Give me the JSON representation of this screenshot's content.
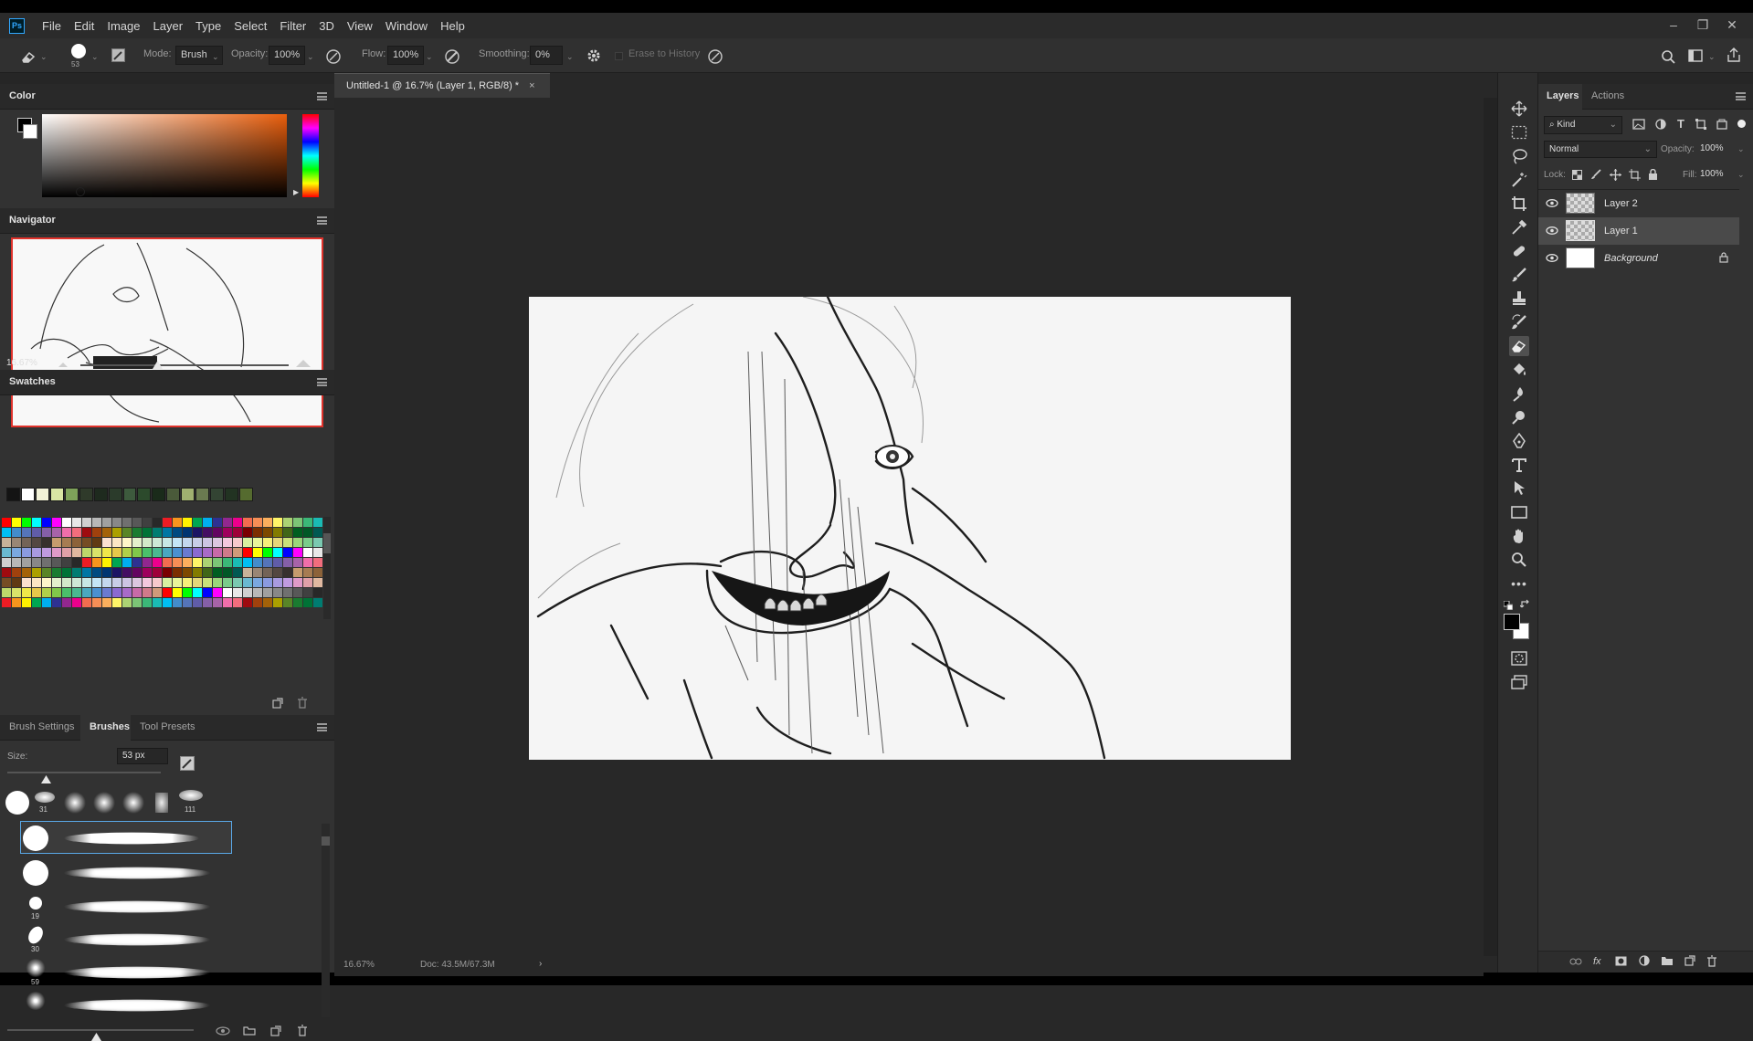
{
  "app": {
    "logo_text": "Ps"
  },
  "menu": [
    "File",
    "Edit",
    "Image",
    "Layer",
    "Type",
    "Select",
    "Filter",
    "3D",
    "View",
    "Window",
    "Help"
  ],
  "options_bar": {
    "brush_size": "53",
    "mode_label": "Mode:",
    "mode_value": "Brush",
    "opacity_label": "Opacity:",
    "opacity_value": "100%",
    "flow_label": "Flow:",
    "flow_value": "100%",
    "smoothing_label": "Smoothing:",
    "smoothing_value": "0%",
    "erase_history_label": "Erase to History"
  },
  "color_panel": {
    "title": "Color",
    "hue_color": "#e95e0c"
  },
  "navigator": {
    "title": "Navigator",
    "zoom": "16.67%"
  },
  "swatches": {
    "title": "Swatches",
    "recent": [
      "#141414",
      "#ffffff",
      "#f2f2d8",
      "#d9e6a4",
      "#7ea25a",
      "#2f3a2a",
      "#1e2a1e",
      "#2b3b2b",
      "#3d5a3d",
      "#2c4a2c",
      "#1a2b1a",
      "#4a5a3a",
      "#a0b070",
      "#6a7a50",
      "#334433",
      "#223322",
      "#556b2f"
    ],
    "grid_colors": [
      "#ff0000",
      "#ffff00",
      "#00ff00",
      "#00ffff",
      "#0000ff",
      "#ff00ff",
      "#ffffff",
      "#e8e8e8",
      "#d0d0d0",
      "#b8b8b8",
      "#a0a0a0",
      "#888888",
      "#707070",
      "#585858",
      "#404040",
      "#282828",
      "#ed1c24",
      "#f7941d",
      "#fff200",
      "#00a651",
      "#00aeef",
      "#2e3192",
      "#92278f",
      "#ec008c",
      "#f26c4f",
      "#f68e56",
      "#fbaf5d",
      "#fff568",
      "#acd373",
      "#7cc576",
      "#3bb878",
      "#1abbb4",
      "#00bff3",
      "#438ccb",
      "#5574b9",
      "#605ca8",
      "#855fa8",
      "#a763a8",
      "#f06eaa",
      "#f26d7d",
      "#9e0b0f",
      "#a0410d",
      "#a36209",
      "#aba000",
      "#598527",
      "#1a7b30",
      "#007236",
      "#007c71",
      "#0076a3",
      "#004a80",
      "#003471",
      "#1b1464",
      "#440e62",
      "#630460",
      "#9e005d",
      "#9e0039",
      "#790000",
      "#7b2e00",
      "#7d4900",
      "#827b00",
      "#406618",
      "#005e20",
      "#005826",
      "#005952"
    ],
    "pastel_colors": [
      "#c7b299",
      "#998675",
      "#736357",
      "#534741",
      "#37302d",
      "#c69c6d",
      "#a67c52",
      "#8c6239",
      "#754c24",
      "#603913",
      "#fbe0d0",
      "#fde6c5",
      "#fff6c9",
      "#e4f0cc",
      "#d3e9c9",
      "#cde8d6",
      "#c7e7e5",
      "#c4e5f6",
      "#c4d7ee",
      "#c8cde7",
      "#cdc4e3",
      "#dcc6e0",
      "#f3c8dd",
      "#f7c9cc",
      "#d8f0a0",
      "#e8f59a",
      "#f5f07a",
      "#e4d77a",
      "#c9e07a",
      "#9ad57a",
      "#7acc8a",
      "#7ac9b0",
      "#6ab9d0",
      "#7aa8e0",
      "#8a9ae0",
      "#a89ae0",
      "#c09ae0",
      "#e09ac8",
      "#e0a0a8",
      "#e0b8a0",
      "#bdd86a",
      "#d9e36a",
      "#f0e84a",
      "#e6c84a",
      "#b0d04a",
      "#80c84a",
      "#4ac06a",
      "#4ab890",
      "#4aa8c0",
      "#4a90d0",
      "#6a7ad0",
      "#8a6ad0",
      "#a86ac8",
      "#c86aa8",
      "#d07a8a",
      "#d09a7a"
    ]
  },
  "brushes_panel": {
    "tabs": [
      "Brush Settings",
      "Brushes",
      "Tool Presets"
    ],
    "size_label": "Size:",
    "size_value": "53 px",
    "preset_numbers": [
      "31",
      "111"
    ],
    "list_sizes": [
      "",
      "",
      "",
      "19",
      "30",
      "59",
      ""
    ]
  },
  "document": {
    "tab_title": "Untitled-1 @ 16.7% (Layer 1, RGB/8) *",
    "close_glyph": "×",
    "zoom": "16.67%",
    "doc_info": "Doc: 43.5M/67.3M"
  },
  "layers_panel": {
    "tabs": [
      "Layers",
      "Actions"
    ],
    "kind_label": "Kind",
    "blend_mode": "Normal",
    "opacity_label": "Opacity:",
    "opacity_value": "100%",
    "lock_label": "Lock:",
    "fill_label": "Fill:",
    "fill_value": "100%",
    "layers": [
      {
        "name": "Layer 2",
        "active": false
      },
      {
        "name": "Layer 1",
        "active": true
      },
      {
        "name": "Background",
        "active": false
      }
    ]
  }
}
